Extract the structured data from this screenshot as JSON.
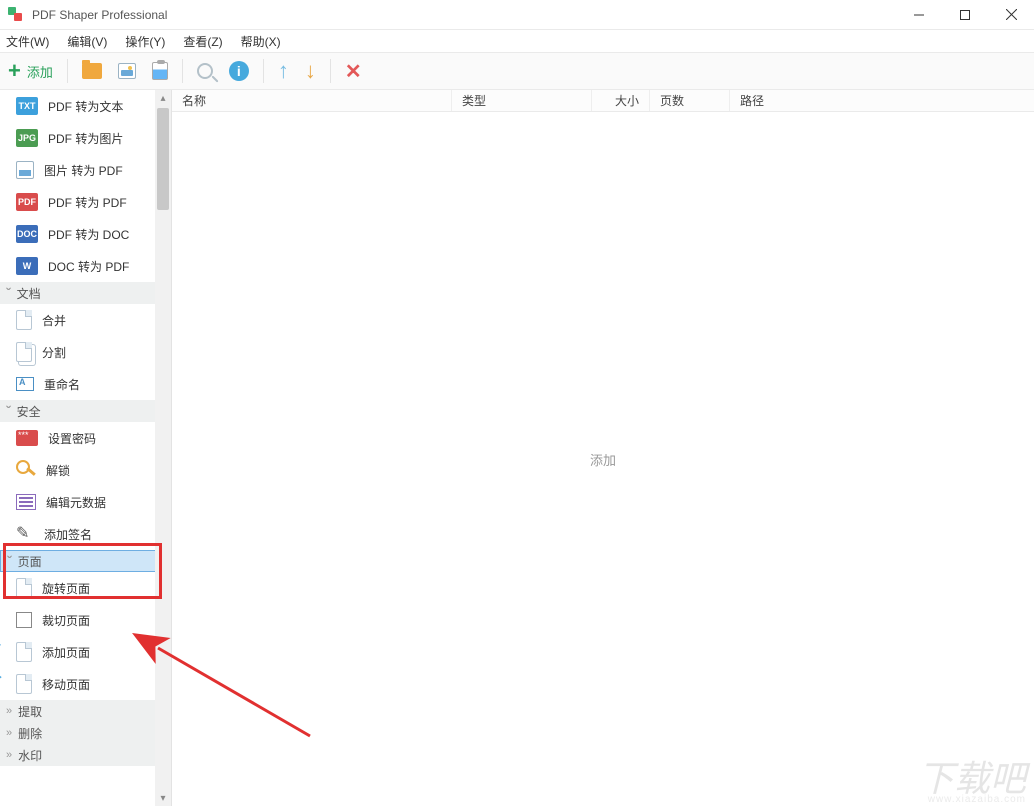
{
  "window": {
    "title": "PDF Shaper Professional"
  },
  "menus": {
    "file": "文件(W)",
    "edit": "编辑(V)",
    "action": "操作(Y)",
    "view": "查看(Z)",
    "help": "帮助(X)"
  },
  "toolbar": {
    "add_label": "添加"
  },
  "sidebar": {
    "convert_items": {
      "pdf_to_txt": "PDF 转为文本",
      "pdf_to_image": "PDF 转为图片",
      "image_to_pdf": "图片 转为 PDF",
      "pdf_to_pdf": "PDF 转为 PDF",
      "pdf_to_doc": "PDF 转为 DOC",
      "doc_to_pdf": "DOC 转为 PDF"
    },
    "cat_doc": "文档",
    "doc_items": {
      "merge": "合并",
      "split": "分割",
      "rename": "重命名"
    },
    "cat_security": "安全",
    "sec_items": {
      "password": "设置密码",
      "unlock": "解锁",
      "metadata": "编辑元数据",
      "sign": "添加签名"
    },
    "cat_pages": "页面",
    "page_items": {
      "rotate": "旋转页面",
      "crop": "裁切页面",
      "add": "添加页面",
      "move": "移动页面"
    },
    "cat_extract": "提取",
    "cat_delete": "删除",
    "cat_watermark": "水印"
  },
  "columns": {
    "name": "名称",
    "type": "类型",
    "size": "大小",
    "pages": "页数",
    "path": "路径"
  },
  "content": {
    "empty_hint": "添加"
  },
  "watermark": {
    "main": "下载吧",
    "sub": "www.xiazaiba.com"
  }
}
